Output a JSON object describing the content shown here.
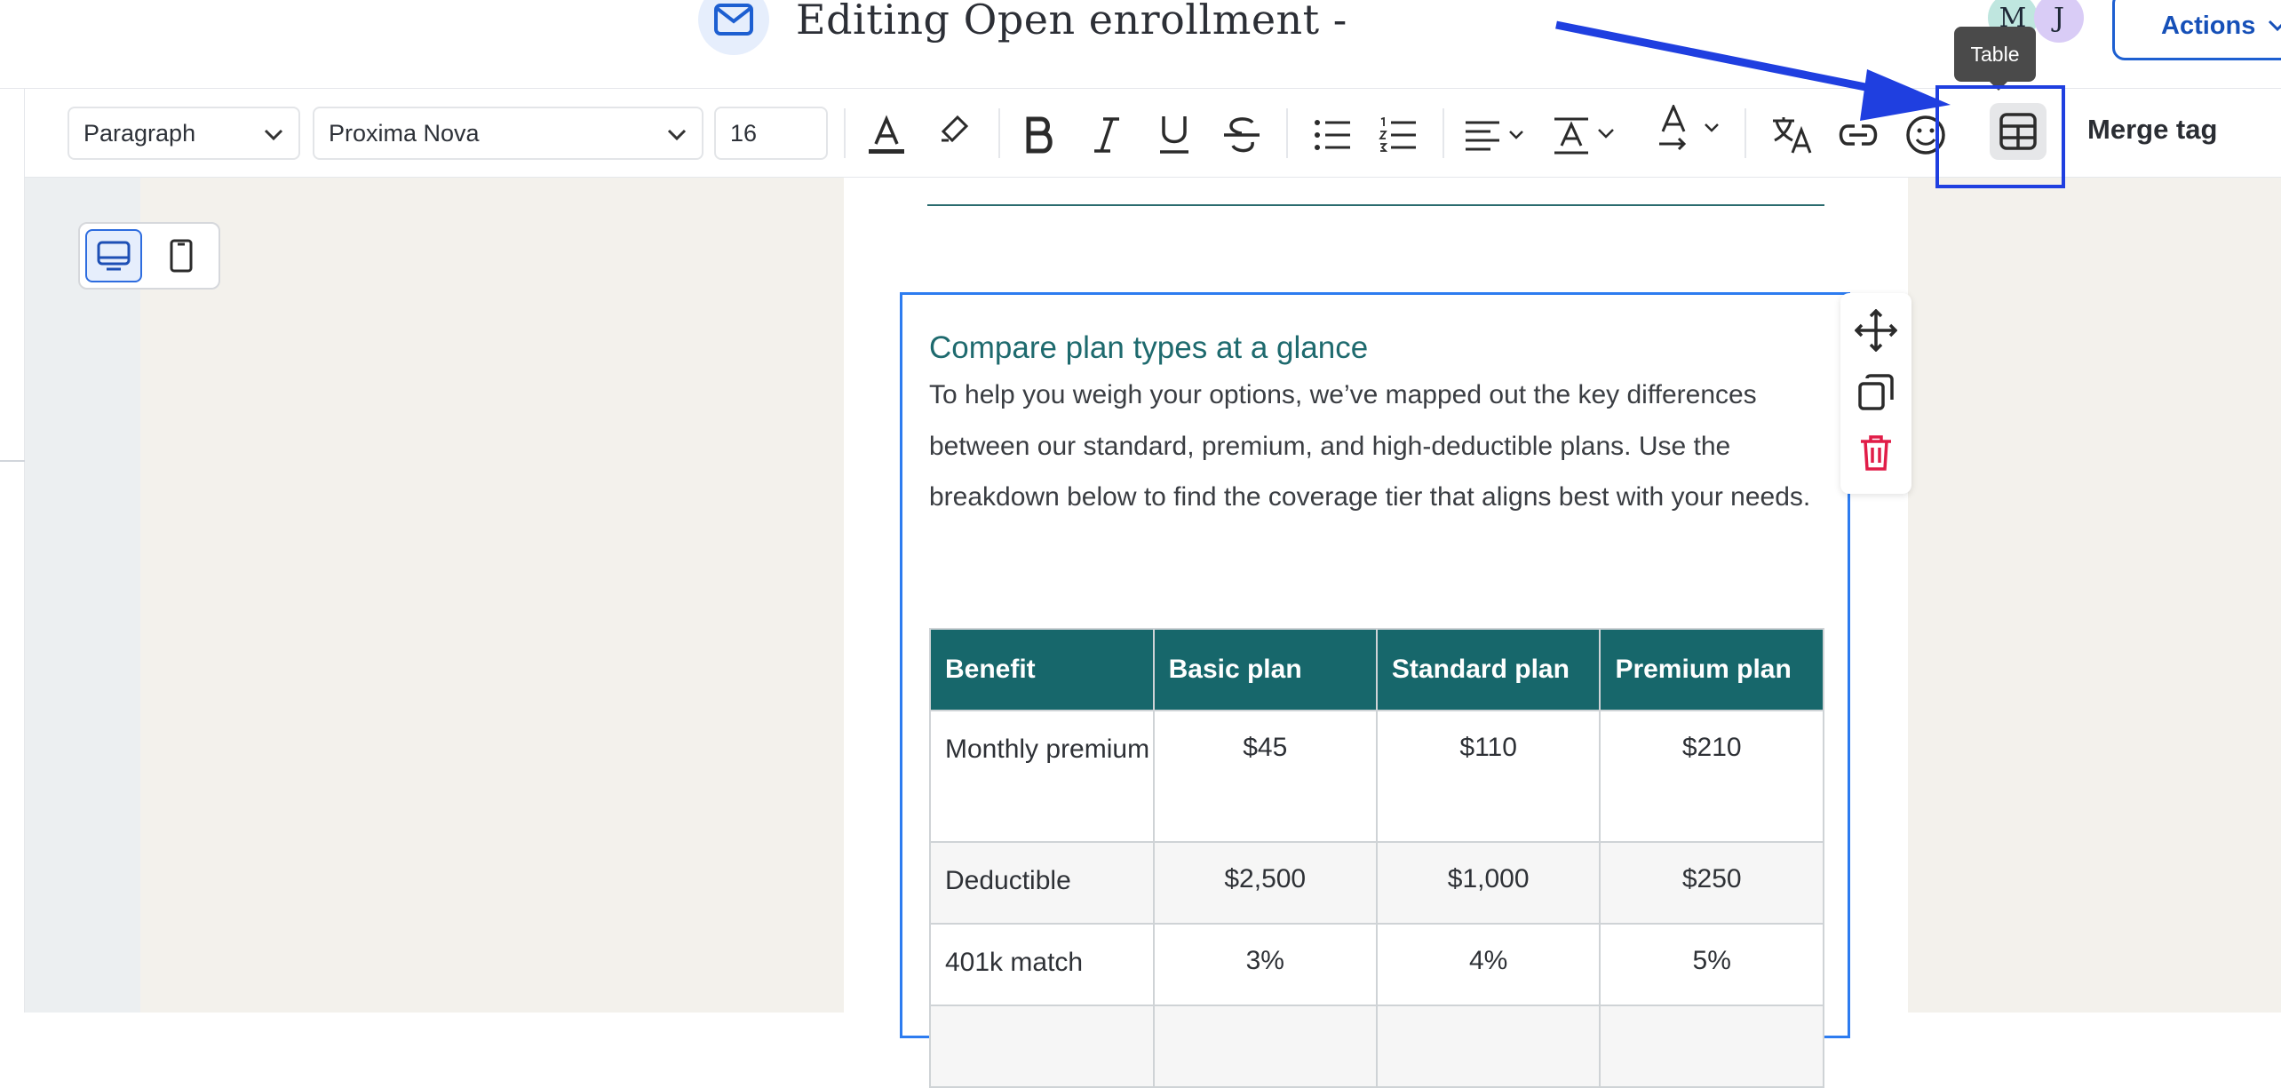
{
  "header": {
    "title": "Editing Open enrollment -",
    "avatars": [
      "M",
      "J"
    ],
    "actions_label": "Actions"
  },
  "toolbar": {
    "block_type": "Paragraph",
    "font_family": "Proxima Nova",
    "font_size": "16",
    "merge_tag_label": "Merge tag",
    "tooltip": "Table",
    "icons": [
      "text-color-icon",
      "highlight-icon",
      "bold-icon",
      "italic-icon",
      "underline-icon",
      "strikethrough-icon",
      "bullet-list-icon",
      "numbered-list-icon",
      "align-icon",
      "line-height-icon",
      "text-direction-icon",
      "translate-icon",
      "link-icon",
      "emoji-icon",
      "table-icon"
    ]
  },
  "view_toggle": {
    "active": "desktop"
  },
  "content": {
    "section_title": "Compare plan types at a glance",
    "body": "To help you weigh your options, we’ve mapped out the key differences between our standard, premium, and high-deductible plans. Use the breakdown below to find the coverage tier that aligns best with your needs.",
    "table": {
      "headers": [
        "Benefit",
        "Basic plan",
        "Standard plan",
        "Premium plan"
      ],
      "rows": [
        [
          "Monthly premium",
          "$45",
          "$110",
          "$210"
        ],
        [
          "Deductible",
          "$2,500",
          "$1,000",
          "$250"
        ],
        [
          "401k match",
          "3%",
          "4%",
          "5%"
        ]
      ]
    }
  },
  "colors": {
    "accent": "#1d5fd1",
    "table_header": "#17676b",
    "heading": "#1e6a6e",
    "annotation": "#1f3fe0",
    "delete": "#e11d48"
  }
}
